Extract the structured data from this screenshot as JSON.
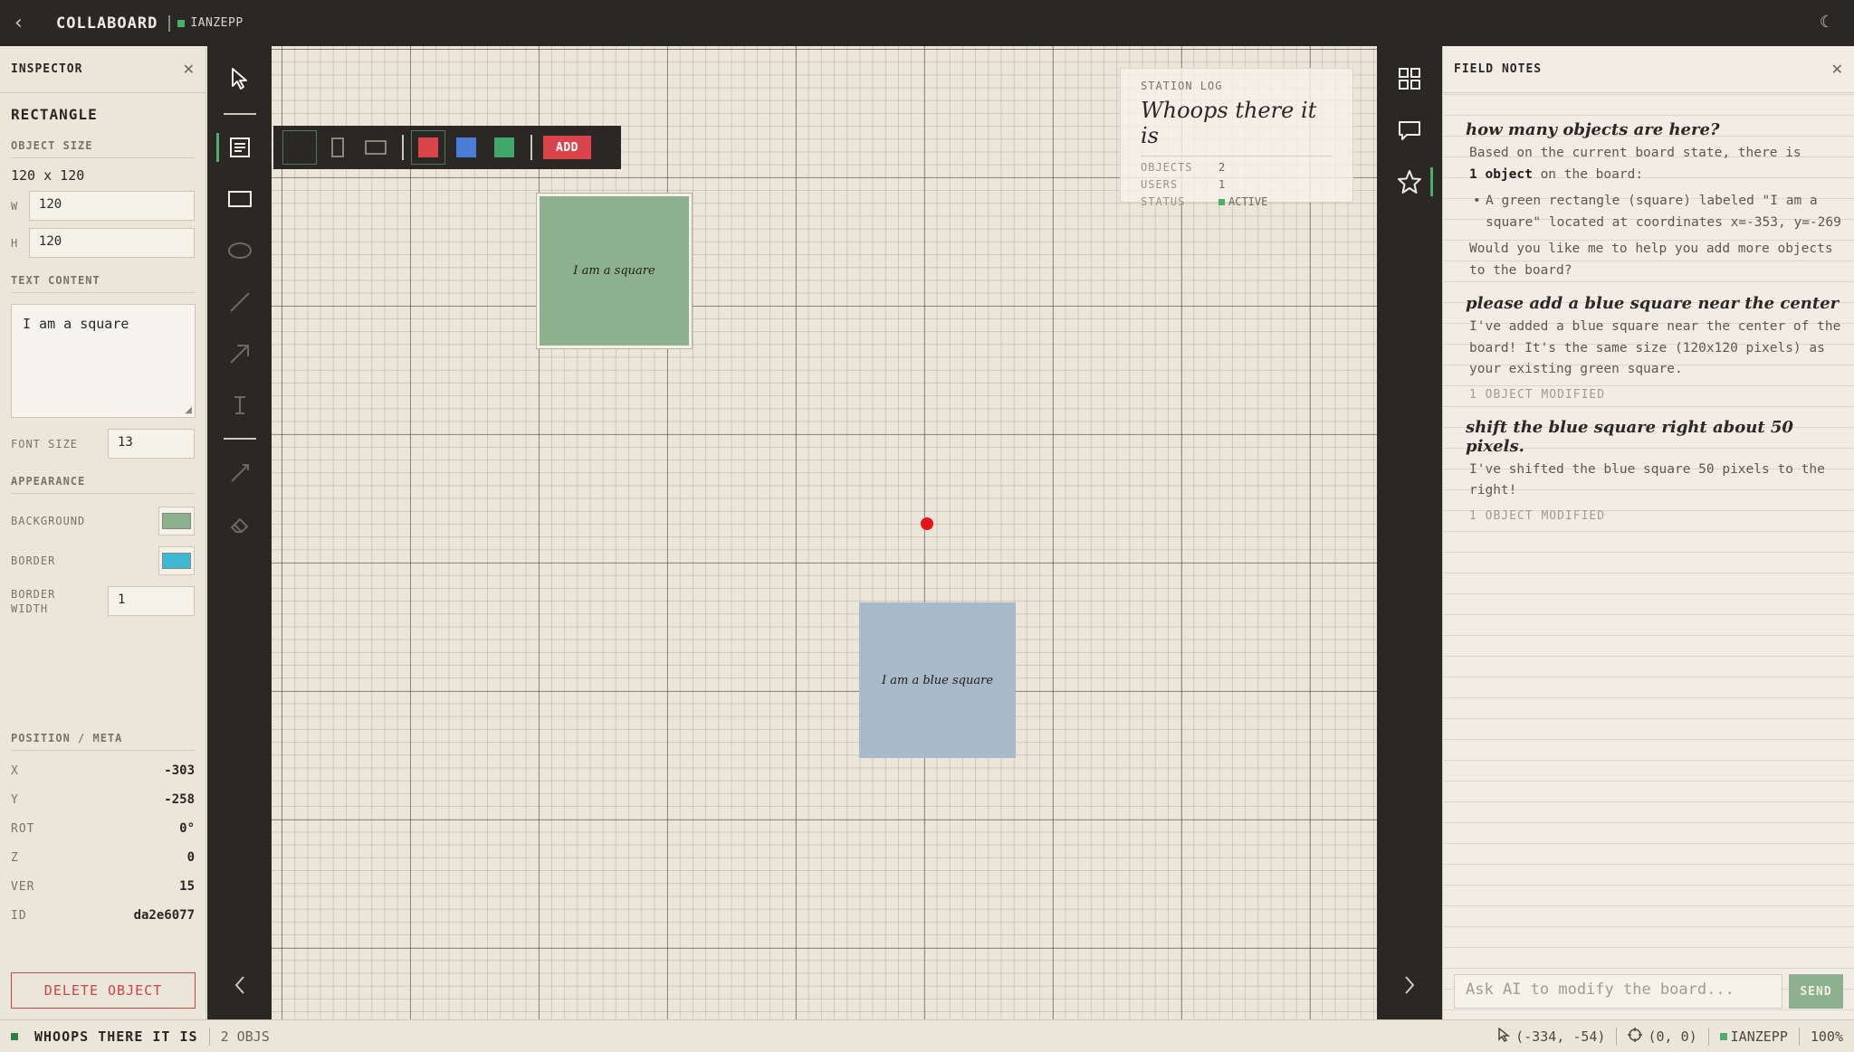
{
  "topbar": {
    "brand": "COLLABOARD",
    "user": "IANZEPP"
  },
  "inspector": {
    "title": "INSPECTOR",
    "object_type": "RECTANGLE",
    "size_section": "OBJECT SIZE",
    "size_display": "120 x 120",
    "w_label": "W",
    "w_value": "120",
    "h_label": "H",
    "h_value": "120",
    "text_section": "TEXT CONTENT",
    "text_value": "I am a square",
    "font_size_label": "FONT SIZE",
    "font_size_value": "13",
    "appearance_section": "APPEARANCE",
    "background_label": "BACKGROUND",
    "background_color": "#8db08e",
    "border_label": "BORDER",
    "border_color": "#3fb8d6",
    "border_width_label": "BORDER WIDTH",
    "border_width_value": "1",
    "meta_section": "POSITION / META",
    "meta": [
      {
        "k": "X",
        "v": "-303"
      },
      {
        "k": "Y",
        "v": "-258"
      },
      {
        "k": "ROT",
        "v": "0°"
      },
      {
        "k": "Z",
        "v": "0"
      },
      {
        "k": "VER",
        "v": "15"
      },
      {
        "k": "ID",
        "v": "da2e6077"
      }
    ],
    "delete_label": "DELETE OBJECT"
  },
  "floatbar": {
    "colors": [
      "#d9454b",
      "#4a7dd6",
      "#3fa866"
    ],
    "add_label": "ADD"
  },
  "canvas": {
    "green_square_text": "I am a square",
    "blue_square_text": "I am a blue square"
  },
  "station": {
    "label": "STATION LOG",
    "title": "Whoops there it is",
    "rows": [
      {
        "k": "OBJECTS",
        "v": "2"
      },
      {
        "k": "USERS",
        "v": "1"
      },
      {
        "k": "STATUS",
        "v": "ACTIVE"
      }
    ]
  },
  "notes": {
    "title": "FIELD NOTES",
    "q1": "how many objects are here?",
    "a1_pre": "Based on the current board state, there is",
    "a1_bold": "1 object",
    "a1_post": "on the board:",
    "a1_bullet": "A green rectangle (square) labeled \"I am a square\" located at coordinates x=-353, y=-269",
    "a1_follow": "Would you like me to help you add more objects to the board?",
    "q2": "please add a blue square near the center",
    "a2": "I've added a blue square near the center of the board! It's the same size (120x120 pixels) as your existing green square.",
    "mod2": "1 OBJECT MODIFIED",
    "q3": "shift the blue square right about 50 pixels.",
    "a3": "I've shifted the blue square 50 pixels to the right!",
    "mod3": "1 OBJECT MODIFIED",
    "input_placeholder": "Ask AI to modify the board...",
    "send_label": "SEND"
  },
  "status": {
    "board_name": "WHOOPS THERE IT IS",
    "obj_count": "2 OBJS",
    "cursor_pos": "(-334, -54)",
    "origin": "(0, 0)",
    "user": "IANZEPP",
    "zoom": "100%"
  }
}
